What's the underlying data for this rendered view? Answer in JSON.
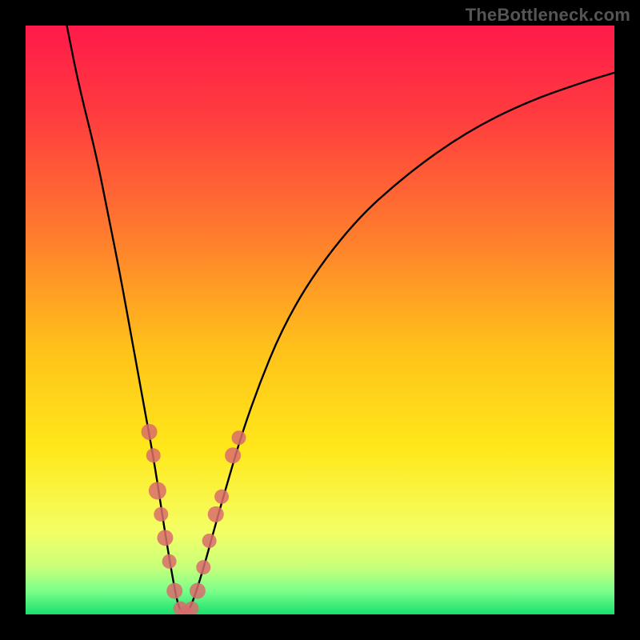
{
  "watermark": "TheBottleneck.com",
  "chart_data": {
    "type": "line",
    "title": "",
    "xlabel": "",
    "ylabel": "",
    "xlim": [
      0,
      100
    ],
    "ylim": [
      0,
      100
    ],
    "series": [
      {
        "name": "bottleneck-curve",
        "x": [
          7,
          9,
          12,
          14,
          16,
          18,
          20,
          22,
          23.5,
          25,
          26,
          27,
          28,
          30,
          33,
          38,
          45,
          55,
          65,
          75,
          85,
          95,
          100
        ],
        "values": [
          100,
          90,
          78,
          68,
          58,
          47,
          36,
          25,
          15,
          6,
          1,
          0,
          1,
          7,
          18,
          35,
          52,
          66,
          75,
          82,
          87,
          90.5,
          92
        ]
      }
    ],
    "markers": {
      "name": "highlighted-points",
      "color": "#d96c6c",
      "points": [
        {
          "x": 21.0,
          "y": 31,
          "r": 10
        },
        {
          "x": 21.7,
          "y": 27,
          "r": 9
        },
        {
          "x": 22.4,
          "y": 21,
          "r": 11
        },
        {
          "x": 23.0,
          "y": 17,
          "r": 9
        },
        {
          "x": 23.7,
          "y": 13,
          "r": 10
        },
        {
          "x": 24.4,
          "y": 9,
          "r": 9
        },
        {
          "x": 25.3,
          "y": 4,
          "r": 10
        },
        {
          "x": 26.3,
          "y": 1,
          "r": 9
        },
        {
          "x": 27.2,
          "y": 0,
          "r": 10
        },
        {
          "x": 28.2,
          "y": 1,
          "r": 9
        },
        {
          "x": 29.2,
          "y": 4,
          "r": 10
        },
        {
          "x": 30.2,
          "y": 8,
          "r": 9
        },
        {
          "x": 31.2,
          "y": 12.5,
          "r": 9
        },
        {
          "x": 32.3,
          "y": 17,
          "r": 10
        },
        {
          "x": 33.3,
          "y": 20,
          "r": 9
        },
        {
          "x": 35.2,
          "y": 27,
          "r": 10
        },
        {
          "x": 36.2,
          "y": 30,
          "r": 9
        }
      ]
    },
    "gradient_stops": [
      {
        "offset": 0,
        "color": "#ff1a4a"
      },
      {
        "offset": 0.15,
        "color": "#ff3b3f"
      },
      {
        "offset": 0.35,
        "color": "#ff7a2e"
      },
      {
        "offset": 0.55,
        "color": "#ffc21a"
      },
      {
        "offset": 0.72,
        "color": "#ffe81a"
      },
      {
        "offset": 0.86,
        "color": "#f4ff66"
      },
      {
        "offset": 0.92,
        "color": "#c8ff7a"
      },
      {
        "offset": 0.96,
        "color": "#7bff8a"
      },
      {
        "offset": 1.0,
        "color": "#19e06f"
      }
    ]
  }
}
